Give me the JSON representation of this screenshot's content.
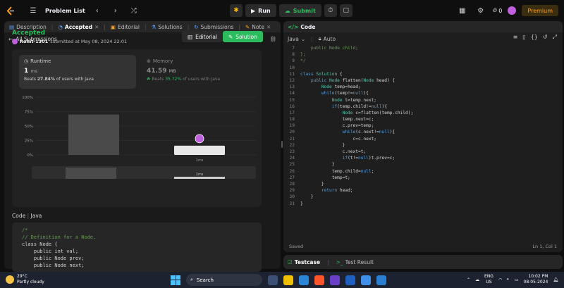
{
  "topnav": {
    "problem_list": "Problem List",
    "run_label": "Run",
    "submit_label": "Submit",
    "streak": "0",
    "premium": "Premium"
  },
  "left": {
    "tabs": [
      {
        "label": "Description",
        "icon": "description-icon"
      },
      {
        "label": "Accepted",
        "icon": "accepted-icon"
      },
      {
        "label": "Editorial",
        "icon": "editorial-icon"
      },
      {
        "label": "Solutions",
        "icon": "solutions-icon"
      },
      {
        "label": "Submissions",
        "icon": "submissions-icon"
      },
      {
        "label": "Note",
        "icon": "note-icon"
      }
    ],
    "back_label": "All Submissions",
    "status": "Accepted",
    "username": "Rohit-1301",
    "submitted_text": "submitted at May 08, 2024 22:01",
    "editorial_btn": "Editorial",
    "solution_btn": "Solution",
    "runtime": {
      "title": "Runtime",
      "value": "1",
      "unit": "ms",
      "beats_prefix": "Beats ",
      "beats_pct": "27.84%",
      "beats_suffix": " of users with Java"
    },
    "memory": {
      "title": "Memory",
      "value": "41.59",
      "unit": "MB",
      "beats_prefix": "Beats ",
      "beats_pct": "35.72%",
      "beats_suffix": " of users with Java"
    },
    "code_label": "Code",
    "code_lang": "Java",
    "code_snippet": "/*\n// Definition for a Node.\nclass Node {\n    public int val;\n    public Node prev;\n    public Node next;"
  },
  "chart_data": {
    "type": "bar",
    "y_ticks": [
      "100%",
      "75%",
      "50%",
      "25%",
      "0%"
    ],
    "ylim": [
      0,
      100
    ],
    "bars": [
      {
        "label": "",
        "value": 70,
        "highlight": false
      },
      {
        "label": "1ms",
        "value": 16,
        "highlight": true
      }
    ],
    "mini_label": "1ms"
  },
  "right": {
    "code_tab": "Code",
    "language": "Java",
    "auto_label": "Auto",
    "lines": [
      {
        "n": "7",
        "t": "    public Node child;"
      },
      {
        "n": "8",
        "t": "};"
      },
      {
        "n": "9",
        "t": "*/"
      },
      {
        "n": "10",
        "t": ""
      },
      {
        "n": "11",
        "t": "class Solution {"
      },
      {
        "n": "12",
        "t": "    public Node flatten(Node head) {"
      },
      {
        "n": "13",
        "t": "        Node temp=head;"
      },
      {
        "n": "14",
        "t": "        while(temp!=null){"
      },
      {
        "n": "15",
        "t": "            Node t=temp.next;"
      },
      {
        "n": "16",
        "t": "            if(temp.child!=null){"
      },
      {
        "n": "17",
        "t": "                Node c=flatten(temp.child);"
      },
      {
        "n": "18",
        "t": "                temp.next=c;"
      },
      {
        "n": "19",
        "t": "                c.prev=temp;"
      },
      {
        "n": "20",
        "t": "                while(c.next!=null){"
      },
      {
        "n": "21",
        "t": "                    c=c.next;"
      },
      {
        "n": "22",
        "t": "                }"
      },
      {
        "n": "23",
        "t": "                c.next=t;"
      },
      {
        "n": "24",
        "t": "                if(t!=null)t.prev=c;"
      },
      {
        "n": "25",
        "t": "            }"
      },
      {
        "n": "26",
        "t": "            temp.child=null;"
      },
      {
        "n": "27",
        "t": "            temp=t;"
      },
      {
        "n": "28",
        "t": "        }"
      },
      {
        "n": "29",
        "t": "        return head;"
      },
      {
        "n": "30",
        "t": "    }"
      },
      {
        "n": "31",
        "t": "}"
      }
    ],
    "saved": "Saved",
    "cursor": "Ln 1, Col 1",
    "testcase": "Testcase",
    "test_result": "Test Result"
  },
  "taskbar": {
    "temp": "29°C",
    "weather": "Partly cloudy",
    "search": "Search",
    "lang1": "ENG",
    "lang2": "US",
    "time": "10:02 PM",
    "date": "08-05-2024"
  },
  "colors": {
    "accent_green": "#2cbb5d",
    "brand_orange": "#ffa116",
    "bg": "#0f0f0f"
  }
}
